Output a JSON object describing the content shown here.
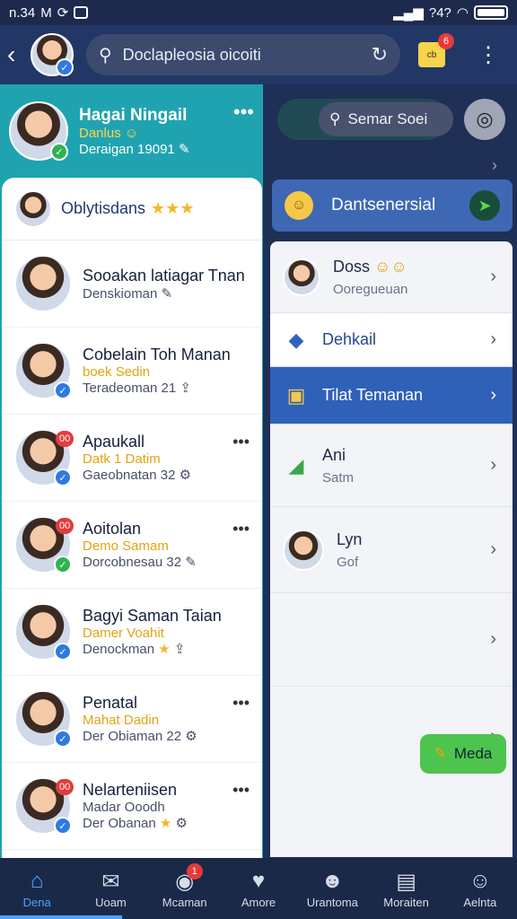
{
  "status_bar": {
    "time": "n.34",
    "right_text": "?4?"
  },
  "top_bar": {
    "search_placeholder": "Doclapleosia oicoiti",
    "calendar_badge": "6",
    "calendar_text": "cb"
  },
  "profile": {
    "name": "Hagai Ningail",
    "subtitle": "Danlus",
    "meta": "Deraigan 19091"
  },
  "left_card": {
    "title": "Oblytisdans",
    "stars": "★★★"
  },
  "contacts": [
    {
      "name": "Sooakan latiagar Tnan",
      "line1": "",
      "line2": "Denskioman",
      "badge": ""
    },
    {
      "name": "Cobelain Toh Manan",
      "line1": "boek Sedin",
      "line2": "Teradeoman 21",
      "badge": ""
    },
    {
      "name": "Apaukall",
      "line1": "Datk 1 Datim",
      "line2": "Gaeobnatan 32",
      "badge": "00"
    },
    {
      "name": "Aoitolan",
      "line1": "Demo Samam",
      "line2": "Dorcobnesau 32",
      "badge": "00"
    },
    {
      "name": "Bagyi Saman Taian",
      "line1": "Damer Voahit",
      "line2": "Denockman",
      "badge": ""
    },
    {
      "name": "Penatal",
      "line1": "Mahat Dadin",
      "line2": "Der Obiaman 22",
      "badge": ""
    },
    {
      "name": "Nelarteniisen",
      "line1": "Madar Ooodh",
      "line2": "Der Obanan",
      "badge": "00"
    }
  ],
  "right_pane": {
    "search_placeholder": "Semar Soei",
    "banner_text": "Dantsenersial",
    "menu": [
      {
        "name": "Doss",
        "sub": "Ooregueuan",
        "icon": "avatar"
      },
      {
        "name": "Dehkail",
        "sub": "",
        "icon": "diamond-icon"
      },
      {
        "name": "Tilat Temanan",
        "sub": "",
        "icon": "person-card-icon"
      },
      {
        "name": "Ani",
        "sub": "Satm",
        "icon": "leaf-icon"
      },
      {
        "name": "Lyn",
        "sub": "Gof",
        "icon": "avatar"
      },
      {
        "name": "",
        "sub": "",
        "icon": ""
      },
      {
        "name": "",
        "sub": "",
        "icon": ""
      }
    ],
    "action_button": "Meda"
  },
  "bottom_nav": [
    {
      "label": "Dena",
      "icon": "home-icon"
    },
    {
      "label": "Uoam",
      "icon": "mail-icon"
    },
    {
      "label": "Mcaman",
      "icon": "bell-icon",
      "badge": "1"
    },
    {
      "label": "Amore",
      "icon": "heart-icon"
    },
    {
      "label": "Urantoma",
      "icon": "user-icon"
    },
    {
      "label": "Moraiten",
      "icon": "news-icon"
    },
    {
      "label": "Aelnta",
      "icon": "profile-icon"
    }
  ]
}
